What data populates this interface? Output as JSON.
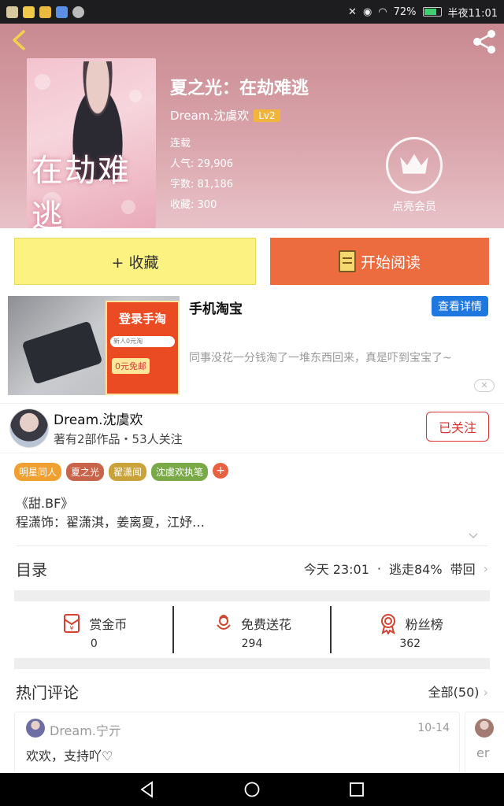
{
  "status_bar": {
    "battery": "72%",
    "time": "半夜11:01"
  },
  "book": {
    "title": "夏之光：在劫难逃",
    "author": "Dream.沈虞欢",
    "level": "Lv2",
    "status": "连载",
    "popularity_label": "人气:",
    "popularity": "29,906",
    "words_label": "字数:",
    "words": "81,186",
    "favorites_label": "收藏:",
    "favorites": "300",
    "cover_text": "在劫难逃",
    "vip_label": "点亮会员"
  },
  "actions": {
    "collect_label": "+ 收藏",
    "read_label": "开始阅读"
  },
  "ad": {
    "title": "手机淘宝",
    "detail_button": "查看详情",
    "description": "同事没花一分钱淘了一堆东西回来，真是吓到宝宝了~",
    "image_headline": "登录手淘",
    "image_search": "新人0元淘",
    "image_badge": "0元免邮"
  },
  "author_card": {
    "name": "Dream.沈虞欢",
    "stats": "著有2部作品・53人关注",
    "follow_label": "已关注"
  },
  "tags": [
    {
      "label": "明星同人",
      "color": "#f0a030"
    },
    {
      "label": "夏之光",
      "color": "#c8644a"
    },
    {
      "label": "翟潇闻",
      "color": "#c9a23a"
    },
    {
      "label": "沈虞欢执笔",
      "color": "#7aaa48"
    }
  ],
  "intro": {
    "line1": "《甜.BF》",
    "line2": "程潇饰：翟潇淇，姜离夏，江妤…"
  },
  "catalog": {
    "title": "目录",
    "time": "今天 23:01",
    "latest": "逃走84%",
    "back": "带回"
  },
  "stats": [
    {
      "label": "赏金币",
      "value": "0",
      "icon": "red-envelope-icon"
    },
    {
      "label": "免费送花",
      "value": "294",
      "icon": "flower-icon"
    },
    {
      "label": "粉丝榜",
      "value": "362",
      "icon": "medal-icon"
    }
  ],
  "comments": {
    "title": "热门评论",
    "all_label": "全部(50)",
    "items": [
      {
        "name": "Dream.宁亓",
        "date": "10-14",
        "text": "欢欢，支持吖♡"
      },
      {
        "name": "er"
      }
    ]
  },
  "colors": {
    "accent_orange": "#ec6c3f",
    "collect_yellow": "#fbf282",
    "link_blue": "#1f77e0",
    "follow_red": "#dd3333"
  }
}
